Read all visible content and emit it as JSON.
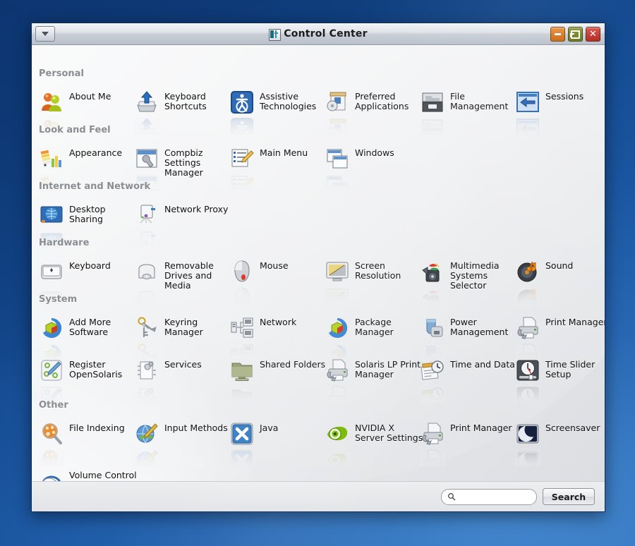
{
  "window": {
    "title": "Control Center",
    "title_icon": "control-center-icon",
    "menu_button_icon": "chevron-down-icon",
    "buttons": {
      "minimize": "minimize-icon",
      "maximize": "maximize-icon",
      "close": "close-icon"
    }
  },
  "colors": {
    "desktop_blue": "#13478c",
    "desktop_blue_light": "#2f72bd",
    "titlebar_top": "#f2f4f6",
    "titlebar_bottom": "#b9c1cb",
    "section_header": "#8a8d91",
    "minimize": "#c96a17",
    "maximize": "#6b7a1c",
    "close": "#b32b22",
    "content_bg": "#eeeff1"
  },
  "sections": [
    {
      "title": "Personal",
      "items": [
        {
          "label": "About\nMe",
          "icon": "about-me-icon"
        },
        {
          "label": "Keyboard\nShortcuts",
          "icon": "keyboard-shortcuts-icon"
        },
        {
          "label": "Assistive\nTechnologies",
          "icon": "assistive-technologies-icon"
        },
        {
          "label": "Preferred\nApplications",
          "icon": "preferred-applications-icon"
        },
        {
          "label": "File\nManagement",
          "icon": "file-management-icon"
        },
        {
          "label": "Sessions",
          "icon": "sessions-icon"
        }
      ]
    },
    {
      "title": "Look and Feel",
      "items": [
        {
          "label": "Appearance",
          "icon": "appearance-icon"
        },
        {
          "label": "Compbiz\nSettings\nManager",
          "icon": "compiz-settings-manager-icon"
        },
        {
          "label": "Main\nMenu",
          "icon": "main-menu-icon"
        },
        {
          "label": "Windows",
          "icon": "windows-icon"
        }
      ]
    },
    {
      "title": "Internet and Network",
      "items": [
        {
          "label": "Desktop\nSharing",
          "icon": "desktop-sharing-icon"
        },
        {
          "label": "Network\nProxy",
          "icon": "network-proxy-icon"
        }
      ]
    },
    {
      "title": "Hardware",
      "items": [
        {
          "label": "Keyboard",
          "icon": "keyboard-icon"
        },
        {
          "label": "Removable\nDrives and\nMedia",
          "icon": "removable-drives-icon"
        },
        {
          "label": "Mouse",
          "icon": "mouse-icon"
        },
        {
          "label": "Screen\nResolution",
          "icon": "screen-resolution-icon"
        },
        {
          "label": "Multimedia\nSystems\nSelector",
          "icon": "multimedia-systems-selector-icon"
        },
        {
          "label": "Sound",
          "icon": "sound-icon"
        }
      ]
    },
    {
      "title": "System",
      "items": [
        {
          "label": "Add More\nSoftware",
          "icon": "add-more-software-icon"
        },
        {
          "label": "Keyring\nManager",
          "icon": "keyring-manager-icon"
        },
        {
          "label": "Network",
          "icon": "network-icon"
        },
        {
          "label": "Package\nManager",
          "icon": "package-manager-icon"
        },
        {
          "label": "Power\nManagement",
          "icon": "power-management-icon"
        },
        {
          "label": "Print\nManager",
          "icon": "print-manager-icon"
        },
        {
          "label": "Register\nOpenSolaris",
          "icon": "register-opensolaris-icon"
        },
        {
          "label": "Services",
          "icon": "services-icon"
        },
        {
          "label": "Shared\nFolders",
          "icon": "shared-folders-icon"
        },
        {
          "label": "Solaris\nLP Print\nManager",
          "icon": "solaris-lp-print-manager-icon"
        },
        {
          "label": "Time and\nData",
          "icon": "time-and-data-icon"
        },
        {
          "label": "Time\nSlider\nSetup",
          "icon": "time-slider-setup-icon"
        }
      ]
    },
    {
      "title": "Other",
      "items": [
        {
          "label": "File\nIndexing",
          "icon": "file-indexing-icon"
        },
        {
          "label": "Input\nMethods",
          "icon": "input-methods-icon"
        },
        {
          "label": "Java",
          "icon": "java-icon"
        },
        {
          "label": "NVIDIA X\nServer\nSettings",
          "icon": "nvidia-x-server-settings-icon"
        },
        {
          "label": "Print\nManager",
          "icon": "print-manager-other-icon"
        },
        {
          "label": "Screensaver",
          "icon": "screensaver-icon"
        },
        {
          "label": "Volume\nControl",
          "icon": "volume-control-icon"
        }
      ]
    }
  ],
  "footer": {
    "search_value": "",
    "search_placeholder": "",
    "search_icon": "search-icon",
    "search_button_label": "Search"
  }
}
